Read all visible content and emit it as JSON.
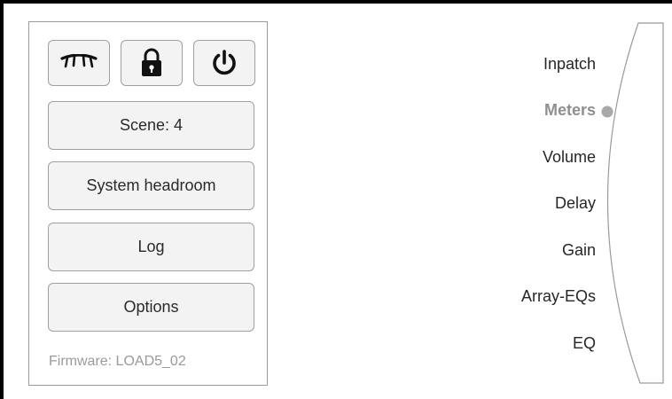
{
  "panel": {
    "icons": [
      {
        "name": "eye-closed-icon"
      },
      {
        "name": "lock-icon"
      },
      {
        "name": "power-icon"
      }
    ],
    "scene_label": "Scene: 4",
    "system_headroom_label": "System headroom",
    "log_label": "Log",
    "options_label": "Options",
    "firmware_text": "Firmware: LOAD5_02"
  },
  "menu": {
    "items": [
      {
        "label": "Inpatch",
        "active": false
      },
      {
        "label": "Meters",
        "active": true
      },
      {
        "label": "Volume",
        "active": false
      },
      {
        "label": "Delay",
        "active": false
      },
      {
        "label": "Gain",
        "active": false
      },
      {
        "label": "Array-EQs",
        "active": false
      },
      {
        "label": "EQ",
        "active": false
      }
    ]
  },
  "colors": {
    "active_text": "#8f8f8f",
    "indicator": "#a8a8a8",
    "button_bg": "#f3f3f3"
  }
}
